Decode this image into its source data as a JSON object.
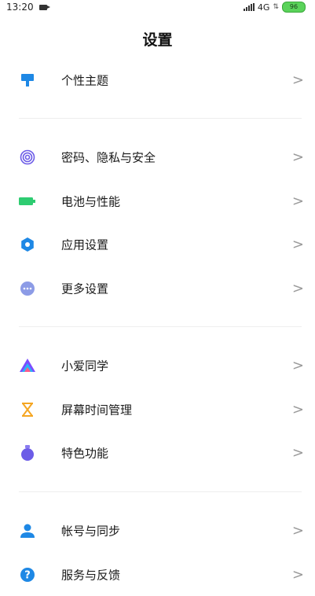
{
  "status_bar": {
    "time": "13:20",
    "network": "4G",
    "battery": "96"
  },
  "header": {
    "title": "设置"
  },
  "items": [
    {
      "label": "个性主题",
      "icon": "theme-brush-icon",
      "color": "#1e88e5"
    },
    {
      "label": "密码、隐私与安全",
      "icon": "fingerprint-icon",
      "color": "#6c5ce7"
    },
    {
      "label": "电池与性能",
      "icon": "battery-icon",
      "color": "#2ecc71"
    },
    {
      "label": "应用设置",
      "icon": "gear-icon",
      "color": "#1e88e5"
    },
    {
      "label": "更多设置",
      "icon": "more-dots-icon",
      "color": "#7b8cde"
    },
    {
      "label": "小爱同学",
      "icon": "xiaoai-icon",
      "color": "#8e44ad"
    },
    {
      "label": "屏幕时间管理",
      "icon": "hourglass-icon",
      "color": "#f5a623"
    },
    {
      "label": "特色功能",
      "icon": "flask-icon",
      "color": "#6c5ce7"
    },
    {
      "label": "帐号与同步",
      "icon": "account-icon",
      "color": "#1e88e5"
    },
    {
      "label": "服务与反馈",
      "icon": "help-icon",
      "color": "#1e88e5"
    }
  ],
  "chevron": ">"
}
